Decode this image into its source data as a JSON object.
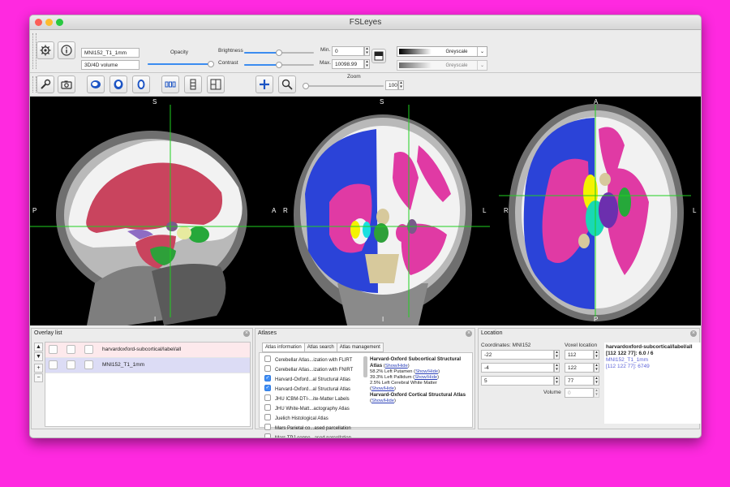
{
  "window": {
    "title": "FSLeyes"
  },
  "toolbar1": {
    "overlay_name": "MNI152_T1_1mm",
    "overlay_type": "3D/4D volume",
    "opacity_label": "Opacity",
    "brightness_label": "Brightness",
    "contrast_label": "Contrast",
    "opacity_fraction": 1.0,
    "brightness_fraction": 0.5,
    "contrast_fraction": 0.5,
    "min_label": "Min.",
    "max_label": "Max.",
    "min_value": "0",
    "max_value": "10098.99",
    "cmap_name": "Greyscale",
    "neg_cmap_name": "Greyscale"
  },
  "toolbar2": {
    "zoom_label": "Zoom",
    "zoom_value": "100",
    "zoom_fraction": 0.0
  },
  "views": {
    "sagittal": {
      "top": "S",
      "bottom": "I",
      "left": "P",
      "right": "A"
    },
    "coronal": {
      "top": "S",
      "bottom": "I",
      "left": "R",
      "right": "L"
    },
    "axial": {
      "top": "A",
      "bottom": "P",
      "left": "R",
      "right": "L"
    }
  },
  "overlay_list": {
    "title": "Overlay list",
    "items": [
      {
        "name": "harvardoxford-subcortical/label/all"
      },
      {
        "name": "MNI152_T1_1mm"
      }
    ]
  },
  "atlases": {
    "title": "Atlases",
    "tabs": [
      "Atlas information",
      "Atlas search",
      "Atlas management"
    ],
    "list": [
      {
        "label": "Cerebellar Atlas...ization with FLIRT",
        "checked": false
      },
      {
        "label": "Cerebellar Atlas...ization with FNIRT",
        "checked": false
      },
      {
        "label": "Harvard-Oxford...al Structural Atlas",
        "checked": true
      },
      {
        "label": "Harvard-Oxford...al Structural Atlas",
        "checked": true
      },
      {
        "label": "JHU ICBM-DTI-...ite-Matter Labels",
        "checked": false
      },
      {
        "label": "JHU White-Matt...actography Atlas",
        "checked": false
      },
      {
        "label": "Juelich Histological Atlas",
        "checked": false
      },
      {
        "label": "Mars Parietal co...ased parcellation",
        "checked": false
      },
      {
        "label": "Mars TPJ conne...ased parcellation",
        "checked": false
      }
    ],
    "info": {
      "sub_title": "Harvard-Oxford Subcortical Structural Atlas",
      "show_hide": "Show/Hide",
      "lines": [
        "58.2% Left Putamen",
        "39.3% Left Pallidum",
        "2.5% Left Cerebral White Matter"
      ],
      "cort_title": "Harvard-Oxford Cortical Structural Atlas"
    }
  },
  "location": {
    "title": "Location",
    "coords_label": "Coordinates: MNI152",
    "voxel_label": "Voxel location",
    "world": [
      "-22",
      "-4",
      "5"
    ],
    "voxel": [
      "112",
      "122",
      "77"
    ],
    "volume_label": "Volume",
    "volume_value": "0",
    "overlay1": "harvardoxford-subcortical/label/all",
    "overlay1_value": "[112 122 77]: 6.0 / 6",
    "overlay2": "MNI152_T1_1mm",
    "overlay2_value": "[112 122 77]: 6749"
  },
  "colors": {
    "background": "#ff29e0",
    "cursor": "#20d020",
    "accent": "#3b8cf0",
    "selected_row": "#dcdcf5",
    "highlight_row": "#fde9ec",
    "blue_link": "#2a3fb8"
  },
  "icons": [
    "gear-icon",
    "info-icon",
    "wrench-icon",
    "camera-icon",
    "sagittal-icon",
    "coronal-icon",
    "axial-icon",
    "lightbox-icon",
    "column-layout-icon",
    "grid-layout-icon",
    "cursor-cross-icon",
    "zoom-icon",
    "eye-icon",
    "link-icon",
    "file-icon",
    "close-icon",
    "dropdown-icon"
  ]
}
